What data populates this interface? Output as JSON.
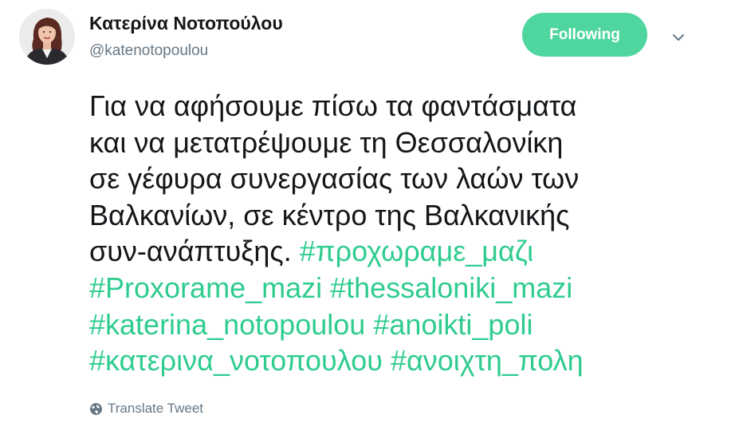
{
  "author": {
    "name": "Κατερίνα Νοτοπούλου",
    "handle": "@katenotopoulou"
  },
  "follow_button": {
    "label": "Following",
    "color": "#4fd69f"
  },
  "tweet": {
    "lines": [
      {
        "text": "Για να αφήσουμε πίσω τα φαντάσματα"
      },
      {
        "text": "και να μετατρέψουμε τη Θεσσαλονίκη"
      },
      {
        "text": "σε γέφυρα συνεργασίας των λαών των"
      },
      {
        "text": "Βαλκανίων, σε κέντρο της Βαλκανικής"
      },
      {
        "text": "συν-ανάπτυξης. ",
        "hashtag": "#προχωραμε_μαζι"
      },
      {
        "hashtags": [
          "#Proxorame_mazi",
          "#thessaloniki_mazi"
        ]
      },
      {
        "hashtags": [
          "#katerina_notopoulou",
          "#anoikti_poli"
        ]
      },
      {
        "hashtags": [
          "#κατερινα_νοτοπουλου",
          "#ανοιχτη_πολη"
        ]
      }
    ],
    "hashtag_color": "#2fcc8f"
  },
  "translate": {
    "label": "Translate Tweet",
    "icon": "globe-icon"
  },
  "icons": {
    "menu": "chevron-down-icon",
    "avatar": "profile-photo"
  }
}
